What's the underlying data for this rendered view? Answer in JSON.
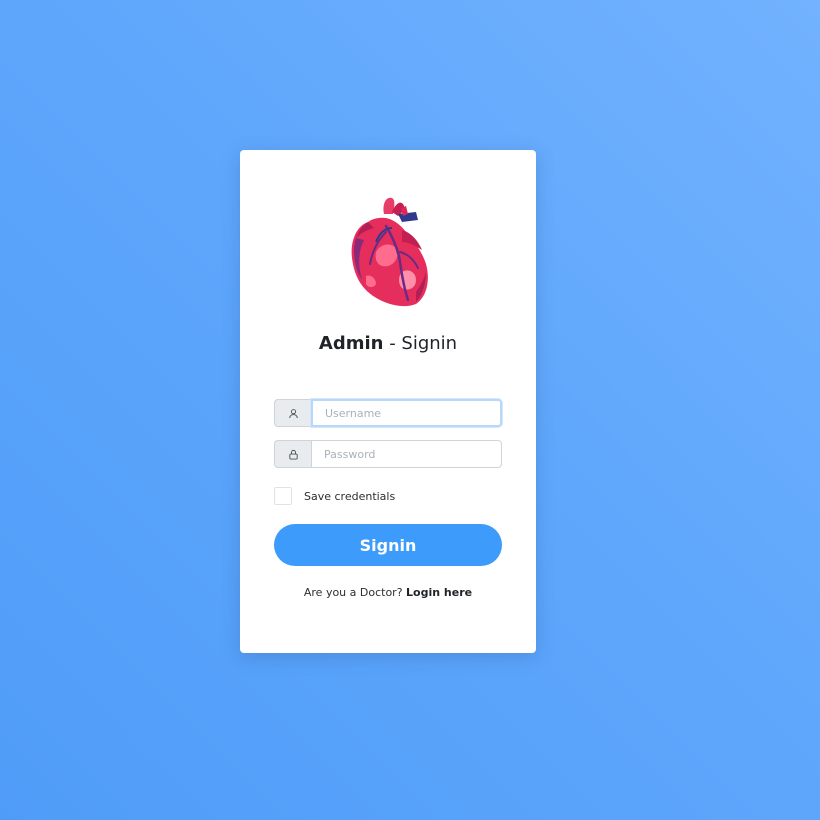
{
  "login": {
    "title_strong": "Admin",
    "title_separator": " - ",
    "title_rest": "Signin",
    "username": {
      "value": "",
      "placeholder": "Username",
      "icon": "user-icon"
    },
    "password": {
      "value": "",
      "placeholder": "Password",
      "icon": "lock-icon"
    },
    "remember_label": "Save credentials",
    "remember_checked": false,
    "signin_label": "Signin",
    "footer_text": "Are you a Doctor? ",
    "footer_link": "Login here",
    "logo": "heart-logo"
  },
  "colors": {
    "background": "#5fa7fc",
    "accent": "#3d9bfb",
    "heart": "#e62e5c"
  }
}
